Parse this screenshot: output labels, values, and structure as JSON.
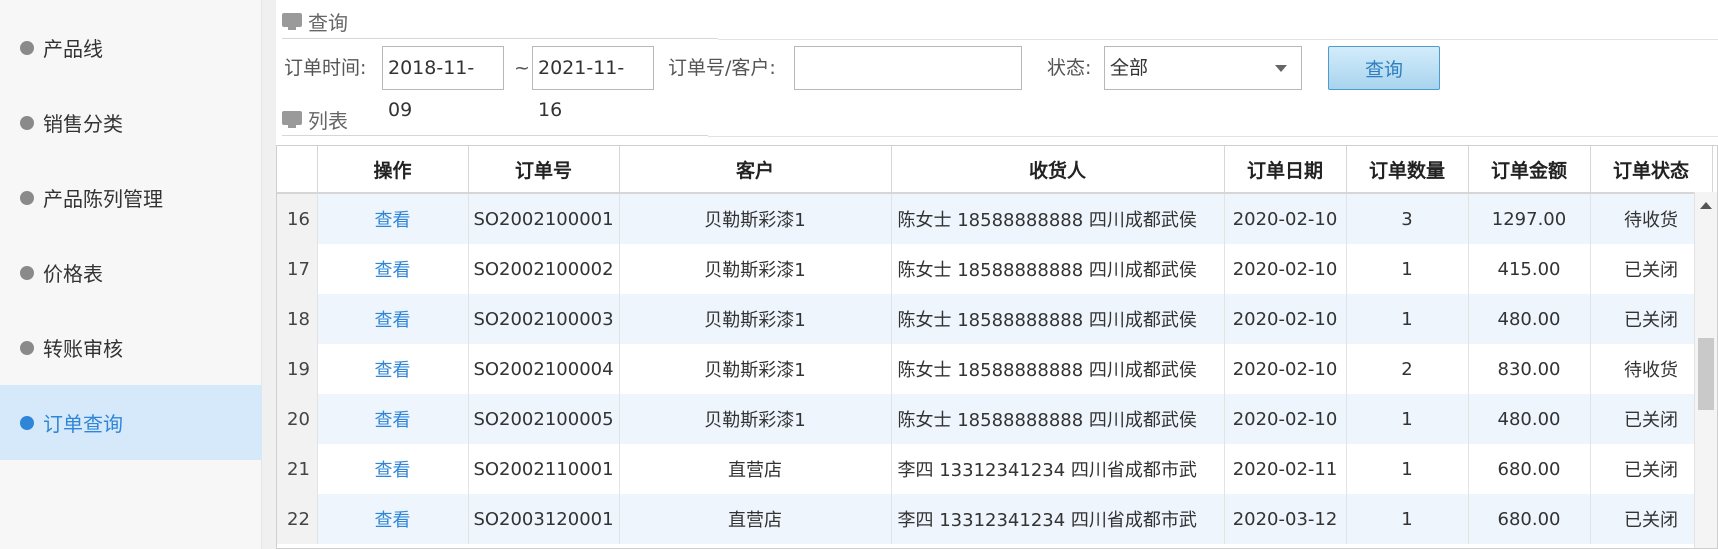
{
  "sidebar": {
    "items": [
      {
        "label": "产品线",
        "active": false
      },
      {
        "label": "销售分类",
        "active": false
      },
      {
        "label": "产品陈列管理",
        "active": false
      },
      {
        "label": "价格表",
        "active": false
      },
      {
        "label": "转账审核",
        "active": false
      },
      {
        "label": "订单查询",
        "active": true
      }
    ]
  },
  "query_section": {
    "title": "查询"
  },
  "list_section": {
    "title": "列表"
  },
  "filters": {
    "time_label": "订单时间:",
    "start_date": "2018-11-09",
    "separator": "~",
    "end_date": "2021-11-16",
    "order_label": "订单号/客户:",
    "order_value": "",
    "status_label": "状态:",
    "status_value": "全部",
    "query_button": "查询"
  },
  "table": {
    "columns": [
      "",
      "操作",
      "订单号",
      "客户",
      "收货人",
      "订单日期",
      "订单数量",
      "订单金额",
      "订单状态"
    ],
    "rows": [
      {
        "no": "16",
        "op": "查看",
        "order": "SO2002100001",
        "customer": "贝勒斯彩漆1",
        "receiver": "陈女士 18588888888 四川成都武侯",
        "date": "2020-02-10",
        "qty": "3",
        "amount": "1297.00",
        "status": "待收货"
      },
      {
        "no": "17",
        "op": "查看",
        "order": "SO2002100002",
        "customer": "贝勒斯彩漆1",
        "receiver": "陈女士 18588888888 四川成都武侯",
        "date": "2020-02-10",
        "qty": "1",
        "amount": "415.00",
        "status": "已关闭"
      },
      {
        "no": "18",
        "op": "查看",
        "order": "SO2002100003",
        "customer": "贝勒斯彩漆1",
        "receiver": "陈女士 18588888888 四川成都武侯",
        "date": "2020-02-10",
        "qty": "1",
        "amount": "480.00",
        "status": "已关闭"
      },
      {
        "no": "19",
        "op": "查看",
        "order": "SO2002100004",
        "customer": "贝勒斯彩漆1",
        "receiver": "陈女士 18588888888 四川成都武侯",
        "date": "2020-02-10",
        "qty": "2",
        "amount": "830.00",
        "status": "待收货"
      },
      {
        "no": "20",
        "op": "查看",
        "order": "SO2002100005",
        "customer": "贝勒斯彩漆1",
        "receiver": "陈女士 18588888888 四川成都武侯",
        "date": "2020-02-10",
        "qty": "1",
        "amount": "480.00",
        "status": "已关闭"
      },
      {
        "no": "21",
        "op": "查看",
        "order": "SO2002110001",
        "customer": "直营店",
        "receiver": "李四 13312341234 四川省成都市武",
        "date": "2020-02-11",
        "qty": "1",
        "amount": "680.00",
        "status": "已关闭"
      },
      {
        "no": "22",
        "op": "查看",
        "order": "SO2003120001",
        "customer": "直营店",
        "receiver": "李四 13312341234 四川省成都市武",
        "date": "2020-03-12",
        "qty": "1",
        "amount": "680.00",
        "status": "已关闭"
      }
    ]
  }
}
